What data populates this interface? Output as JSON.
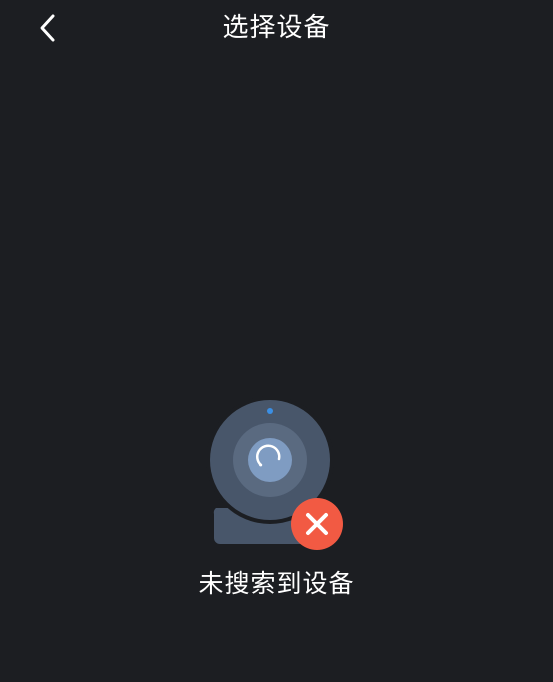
{
  "header": {
    "title": "选择设备",
    "back_icon": "chevron-left-icon"
  },
  "empty_state": {
    "message": "未搜索到设备",
    "illustration_icon": "webcam-icon",
    "error_badge_icon": "close-icon"
  },
  "colors": {
    "background": "#1c1e22",
    "text": "#ffffff",
    "camera_body": "#48566a",
    "camera_ring": "#5a6a80",
    "camera_lens": "#7f9cc2",
    "indicator_led": "#3b8fe4",
    "error_badge": "#f25a43"
  }
}
